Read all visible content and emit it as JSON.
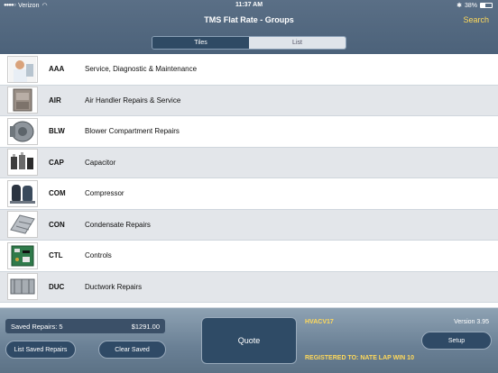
{
  "status_bar": {
    "carrier": "Verizon",
    "time": "11:37 AM",
    "battery": "38%",
    "battery_level": 0.38
  },
  "nav": {
    "title": "TMS Flat Rate  -  Groups",
    "search": "Search"
  },
  "view_toggle": {
    "tiles": "Tiles",
    "list": "List",
    "selected": "Tiles"
  },
  "groups": [
    {
      "code": "AAA",
      "name": "Service, Diagnostic & Maintenance",
      "icon": "technician-photo"
    },
    {
      "code": "AIR",
      "name": "Air Handler Repairs & Service",
      "icon": "air-handler-photo"
    },
    {
      "code": "BLW",
      "name": "Blower Compartment Repairs",
      "icon": "blower-photo"
    },
    {
      "code": "CAP",
      "name": "Capacitor",
      "icon": "capacitor-photo"
    },
    {
      "code": "COM",
      "name": "Compressor",
      "icon": "compressor-photo"
    },
    {
      "code": "CON",
      "name": "Condensate Repairs",
      "icon": "condensate-pan-photo"
    },
    {
      "code": "CTL",
      "name": "Controls",
      "icon": "control-board-photo"
    },
    {
      "code": "DUC",
      "name": "Ductwork Repairs",
      "icon": "ductwork-photo"
    }
  ],
  "footer": {
    "saved_label": "Saved Repairs:  5",
    "saved_total": "$1291.00",
    "list_saved": "List Saved Repairs",
    "clear_saved": "Clear Saved",
    "quote": "Quote",
    "device_code": "HVACV17",
    "version": "Version 3.95",
    "setup": "Setup",
    "registered": "REGISTERED TO:  NATE LAP WIN 10"
  }
}
